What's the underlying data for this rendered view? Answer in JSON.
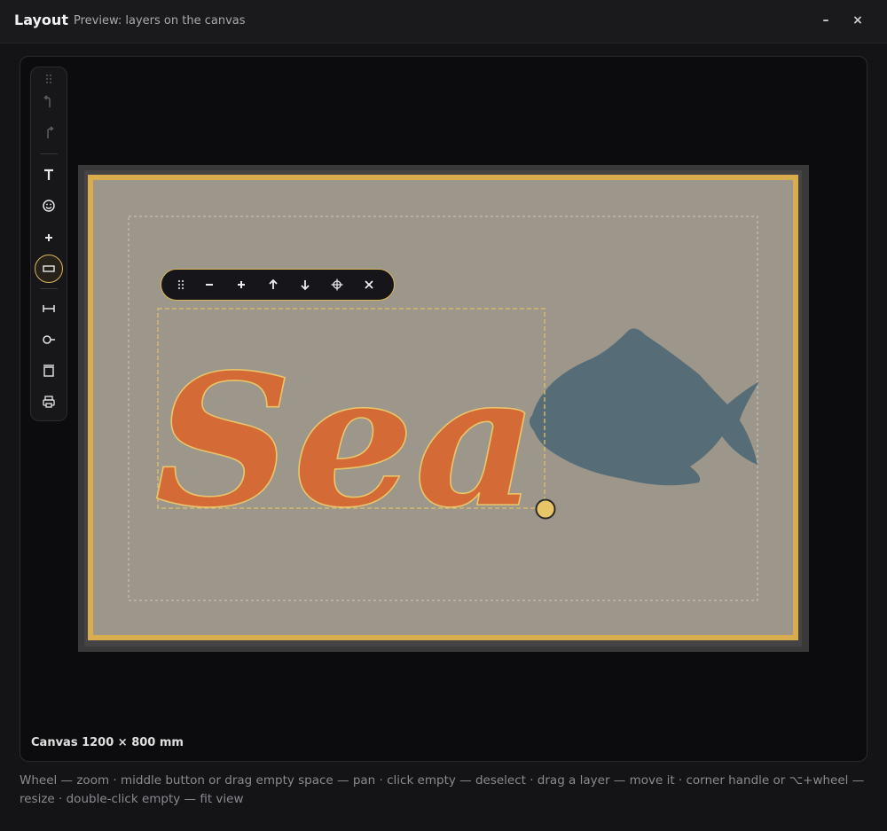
{
  "window": {
    "title": "Layout",
    "subtitle": "Preview: layers on the canvas",
    "minimize_label": "–",
    "close_label": "×"
  },
  "canvas": {
    "info": "Canvas 1200 × 800 mm",
    "bg_color": "#9c968b",
    "border_color": "#d9ad4e"
  },
  "text_layer": {
    "text": "Sea",
    "fill": "#d46a35",
    "outline": "#e8c56a"
  },
  "fish_layer": {
    "fill": "#566d78"
  },
  "toolbar": {
    "tools": [
      "drag-handle-icon",
      "undo-icon",
      "redo-icon",
      "text-icon",
      "emoji-icon",
      "plus-icon",
      "rectangle-icon",
      "width-icon",
      "circle-line-icon",
      "frame-icon",
      "print-icon"
    ]
  },
  "floating_toolbar": {
    "buttons": [
      "drag-icon",
      "minus-icon",
      "plus-icon",
      "arrow-up-icon",
      "arrow-down-icon",
      "center-icon",
      "close-icon"
    ]
  },
  "hint": "Wheel — zoom · middle button or drag empty space — pan · click empty — deselect · drag a layer — move it · corner handle or ⌥+wheel — resize · double-click empty — fit view",
  "colors": {
    "accent": "#d9b55c"
  }
}
